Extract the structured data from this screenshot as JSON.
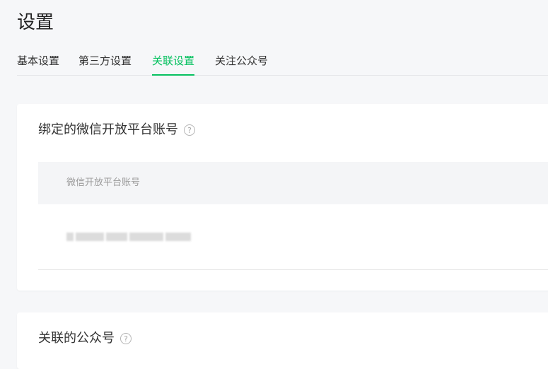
{
  "page": {
    "title": "设置"
  },
  "tabs": [
    {
      "label": "基本设置",
      "active": false
    },
    {
      "label": "第三方设置",
      "active": false
    },
    {
      "label": "关联设置",
      "active": true
    },
    {
      "label": "关注公众号",
      "active": false
    }
  ],
  "colors": {
    "accent": "#07c160",
    "background": "#f6f7f9",
    "card": "#ffffff",
    "table_header_bg": "#f4f5f7"
  },
  "sections": [
    {
      "title": "绑定的微信开放平台账号",
      "help_icon": "question-circle-icon",
      "table": {
        "columns": [
          "微信开放平台账号"
        ]
      }
    },
    {
      "title": "关联的公众号",
      "help_icon": "question-circle-icon"
    }
  ]
}
